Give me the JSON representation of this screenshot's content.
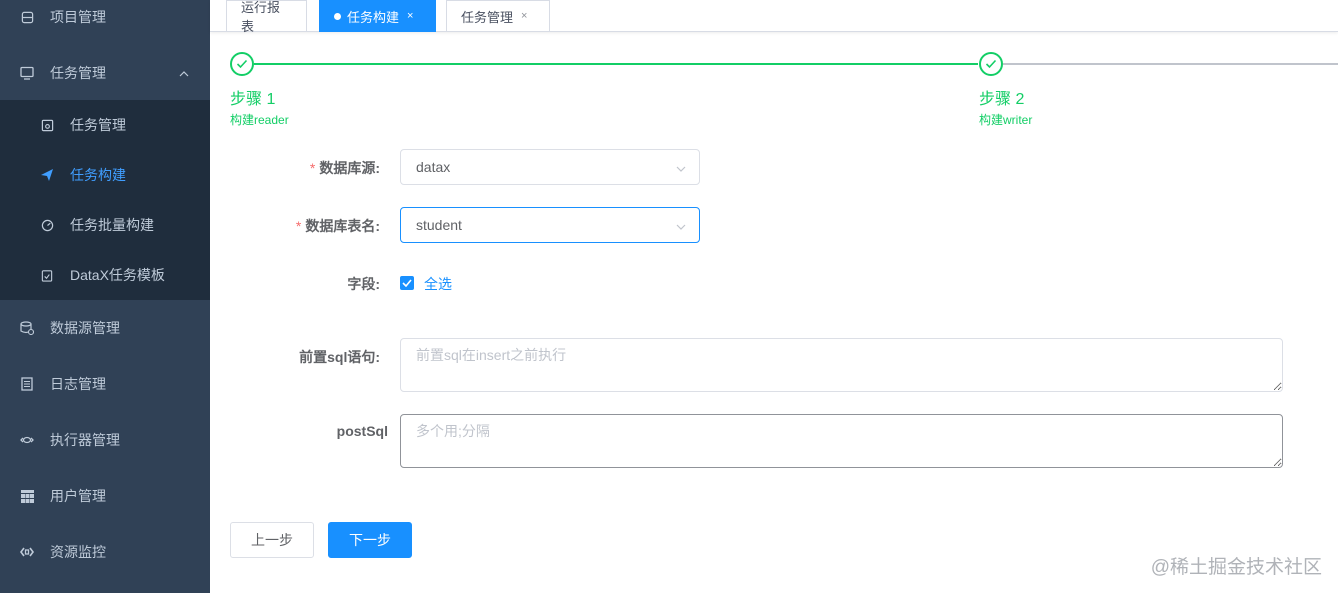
{
  "sidebar": {
    "items": [
      {
        "label": "项目管理",
        "icon": "database-icon"
      },
      {
        "label": "任务管理",
        "icon": "monitor-icon"
      },
      {
        "label": "数据源管理",
        "icon": "database-stack-icon"
      },
      {
        "label": "日志管理",
        "icon": "document-icon"
      },
      {
        "label": "执行器管理",
        "icon": "cloud-link-icon"
      },
      {
        "label": "用户管理",
        "icon": "grid-table-icon"
      },
      {
        "label": "资源监控",
        "icon": "code-icon"
      }
    ],
    "submenu": [
      {
        "label": "任务管理",
        "icon": "calendar-icon"
      },
      {
        "label": "任务构建",
        "icon": "paper-plane-icon"
      },
      {
        "label": "任务批量构建",
        "icon": "dashboard-icon"
      },
      {
        "label": "DataX任务模板",
        "icon": "clipboard-icon"
      }
    ]
  },
  "tabs": [
    {
      "label": "运行报表"
    },
    {
      "label": "任务构建",
      "close": "×"
    },
    {
      "label": "任务管理",
      "close": "×"
    }
  ],
  "steps": [
    {
      "title": "步骤 1",
      "desc": "构建reader"
    },
    {
      "title": "步骤 2",
      "desc": "构建writer"
    }
  ],
  "form": {
    "datasource": {
      "label": "数据库源:",
      "value": "datax"
    },
    "table": {
      "label": "数据库表名:",
      "value": "student"
    },
    "fields": {
      "label": "字段:",
      "checkbox_label": "全选"
    },
    "pre_sql": {
      "label": "前置sql语句:",
      "placeholder": "前置sql在insert之前执行"
    },
    "post_sql": {
      "label": "postSql",
      "placeholder": "多个用;分隔"
    },
    "required_mark": "*"
  },
  "buttons": {
    "prev": "上一步",
    "next": "下一步"
  },
  "watermark": "@稀土掘金技术社区",
  "colors": {
    "sidebar_bg": "#304156",
    "submenu_bg": "#1f2d3d",
    "primary": "#1890ff",
    "success": "#13ce66",
    "danger": "#f56c6c"
  }
}
